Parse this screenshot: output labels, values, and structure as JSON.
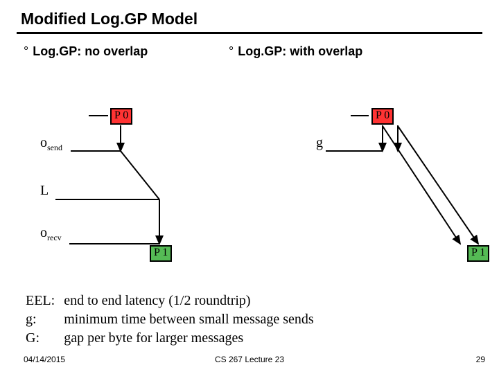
{
  "title": "Modified Log.GP Model",
  "left": {
    "heading": "Log.GP: no overlap"
  },
  "right": {
    "heading": "Log.GP: with overlap"
  },
  "nodes": {
    "p0": "P 0",
    "p1": "P 1"
  },
  "labels": {
    "osend_html": "o<sub>send</sub>",
    "L": "L",
    "orecv_html": "o<sub>recv</sub>",
    "g": "g"
  },
  "defs": {
    "EEL": {
      "key": "EEL:",
      "text": "end to end latency (1/2 roundtrip)"
    },
    "g": {
      "key": "g:",
      "text": "minimum time between small message sends"
    },
    "G": {
      "key": "G:",
      "text": "gap per byte for larger messages"
    }
  },
  "footer": {
    "date": "04/14/2015",
    "center": "CS 267 Lecture 23",
    "page": "29"
  }
}
